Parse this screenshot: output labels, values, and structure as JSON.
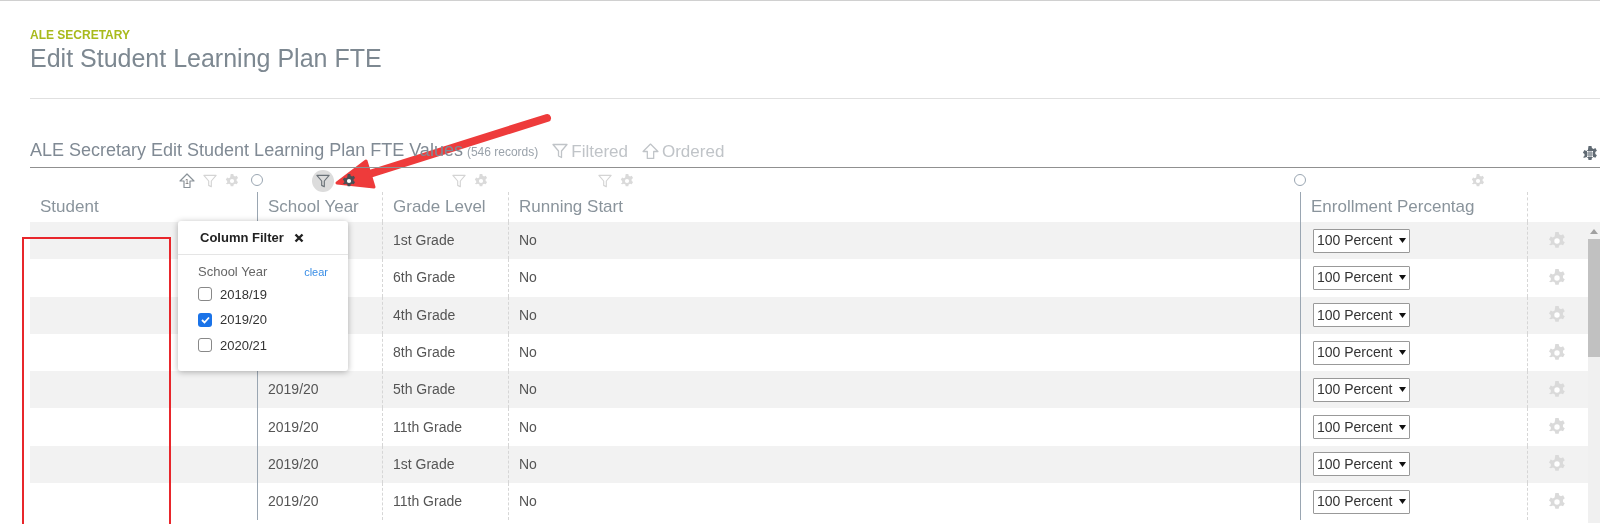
{
  "app": {
    "section": "ALE SECRETARY",
    "title": "Edit Student Learning Plan FTE"
  },
  "grid": {
    "title": "ALE Secretary Edit Student Learning Plan FTE Values",
    "record_count": "(546 records)",
    "filtered_label": "Filtered",
    "ordered_label": "Ordered",
    "columns": [
      {
        "label": "Student",
        "sort_rank": "1",
        "has_filter": true,
        "filter_active": false,
        "menu_active": false,
        "resizable": false
      },
      {
        "label": "School Year",
        "has_filter": true,
        "filter_active": true,
        "menu_active": true,
        "resizable": true
      },
      {
        "label": "Grade Level",
        "has_filter": true,
        "filter_active": false,
        "menu_active": false,
        "resizable": false
      },
      {
        "label": "Running Start",
        "has_filter": true,
        "filter_active": false,
        "menu_active": false,
        "resizable": false
      },
      {
        "label": "Enrollment Percentag",
        "has_filter": false,
        "menu_active": false,
        "resizable": true
      }
    ],
    "rows": [
      {
        "grade_level": "1st Grade",
        "running_start": "No",
        "enrollment": "100 Percent"
      },
      {
        "grade_level": "6th Grade",
        "running_start": "No",
        "enrollment": "100 Percent"
      },
      {
        "grade_level": "4th Grade",
        "running_start": "No",
        "enrollment": "100 Percent"
      },
      {
        "grade_level": "8th Grade",
        "running_start": "No",
        "enrollment": "100 Percent"
      },
      {
        "school_year": "2019/20",
        "grade_level": "5th Grade",
        "running_start": "No",
        "enrollment": "100 Percent"
      },
      {
        "school_year": "2019/20",
        "grade_level": "11th Grade",
        "running_start": "No",
        "enrollment": "100 Percent"
      },
      {
        "school_year": "2019/20",
        "grade_level": "1st Grade",
        "running_start": "No",
        "enrollment": "100 Percent"
      },
      {
        "school_year": "2019/20",
        "grade_level": "11th Grade",
        "running_start": "No",
        "enrollment": "100 Percent"
      }
    ]
  },
  "column_filter": {
    "title": "Column Filter",
    "field": "School Year",
    "clear": "clear",
    "options": [
      {
        "label": "2018/19",
        "checked": false
      },
      {
        "label": "2019/20",
        "checked": true
      },
      {
        "label": "2020/21",
        "checked": false
      }
    ]
  }
}
